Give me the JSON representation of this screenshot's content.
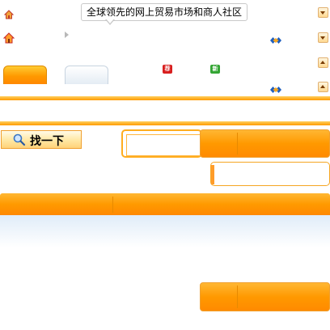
{
  "header": {
    "tooltip_text": "全球领先的网上贸易市场和商人社区"
  },
  "badges": {
    "hot_label": "荐",
    "new_label": "新"
  },
  "search": {
    "button_label": "找一下"
  },
  "colors": {
    "accent_orange": "#ff9900",
    "accent_light": "#ffd060",
    "tab_inactive": "#e4ecf4"
  },
  "icons": [
    "home-icon",
    "house-icon",
    "diamond-icon",
    "play-arrow-icon",
    "magnifier-icon",
    "chevron-down-icon",
    "chevron-up-icon"
  ]
}
